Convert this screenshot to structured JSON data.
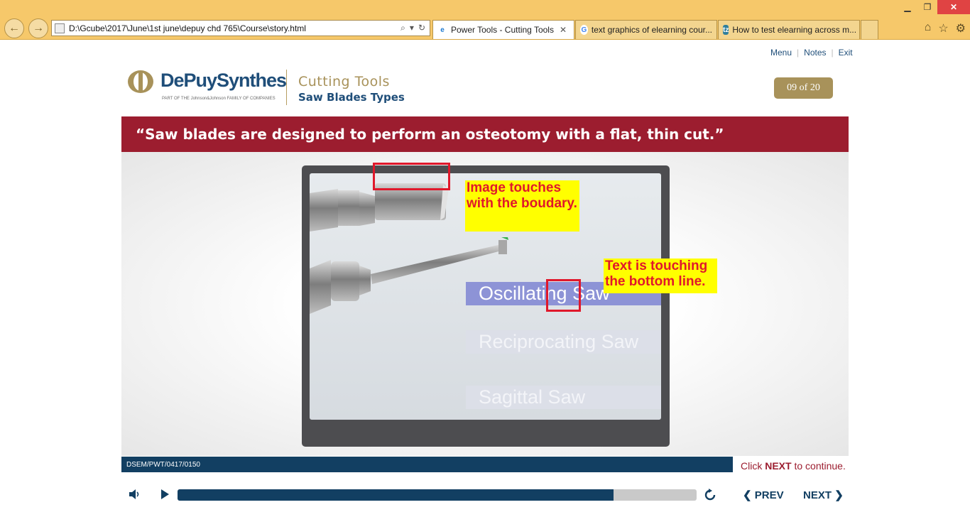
{
  "browser": {
    "address": "D:\\Gcube\\2017\\June\\1st june\\depuy chd 765\\Course\\story.html",
    "tabs": [
      {
        "label": "Power Tools - Cutting Tools",
        "close": "✕"
      },
      {
        "label": "text graphics of elearning cour..."
      },
      {
        "label": "How to test elearning across m..."
      }
    ]
  },
  "course": {
    "menu": [
      "Menu",
      "Notes",
      "Exit"
    ],
    "brand": "DePuySynthes",
    "brand_sub": "PART OF THE Johnson&Johnson FAMILY OF COMPANIES",
    "title": "Cutting Tools",
    "subtitle": "Saw Blades Types",
    "page_counter": "09 of 20"
  },
  "slide": {
    "quote": "“Saw blades are designed to perform an osteotomy with a flat, thin cut.”",
    "options": [
      "Oscillating Saw",
      "Reciprocating Saw",
      "Sagittal Saw"
    ],
    "callouts": [
      "Image touches with the boudary.",
      "Text is touching the bottom line."
    ]
  },
  "footer": {
    "code": "DSEM/PWT/0417/0150",
    "hint_pre": "Click ",
    "hint_bold": "NEXT",
    "hint_post": " to continue.",
    "progress": 0.84,
    "prev_label": "PREV",
    "next_label": "NEXT"
  },
  "colors": {
    "banner": "#9c1d2f",
    "navy": "#123f62",
    "gold": "#a8925a",
    "highlight": "#ffff00",
    "annotation_red": "#e0182b"
  }
}
